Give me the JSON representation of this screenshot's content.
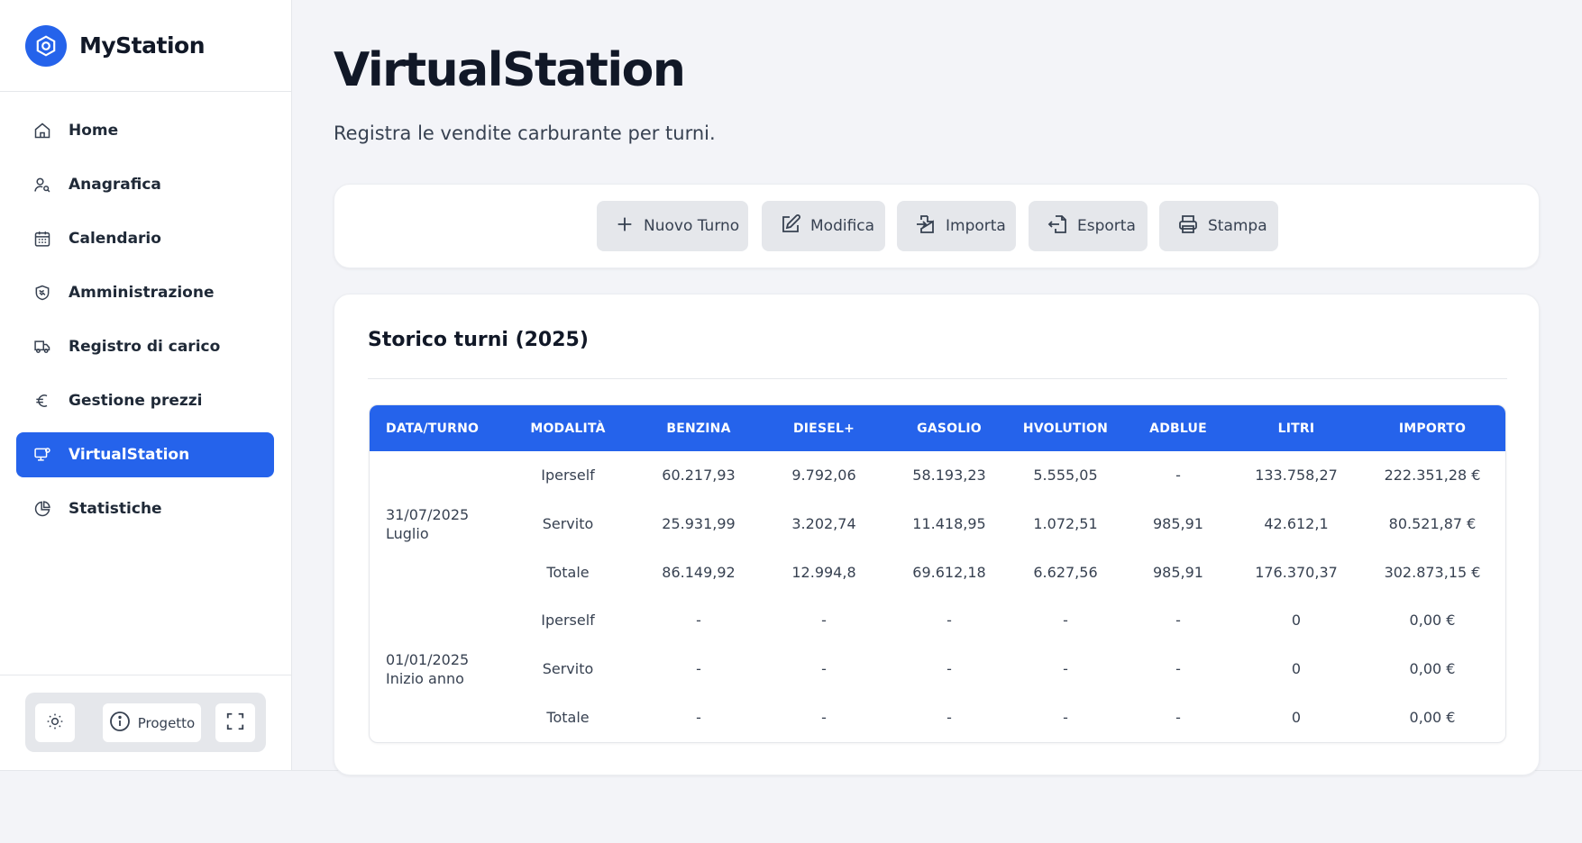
{
  "app": {
    "name": "MyStation",
    "accent": "#2563eb"
  },
  "sidebar": {
    "items": [
      {
        "label": "Home",
        "icon": "home-icon",
        "active": false
      },
      {
        "label": "Anagrafica",
        "icon": "user-search-icon",
        "active": false
      },
      {
        "label": "Calendario",
        "icon": "calendar-icon",
        "active": false
      },
      {
        "label": "Amministrazione",
        "icon": "handshake-icon",
        "active": false
      },
      {
        "label": "Registro di carico",
        "icon": "truck-icon",
        "active": false
      },
      {
        "label": "Gestione prezzi",
        "icon": "euro-icon",
        "active": false
      },
      {
        "label": "VirtualStation",
        "icon": "monitor-icon",
        "active": true
      },
      {
        "label": "Statistiche",
        "icon": "pie-chart-icon",
        "active": false
      }
    ],
    "footer": {
      "theme_icon": "sun-icon",
      "project_label": "Progetto",
      "project_icon": "info-icon",
      "fullscreen_icon": "fullscreen-icon"
    }
  },
  "page": {
    "title": "VirtualStation",
    "subtitle": "Registra le vendite carburante per turni."
  },
  "toolbar": {
    "buttons": [
      {
        "label": "Nuovo Turno",
        "icon": "plus-icon"
      },
      {
        "label": "Modifica",
        "icon": "edit-icon"
      },
      {
        "label": "Importa",
        "icon": "import-icon"
      },
      {
        "label": "Esporta",
        "icon": "export-icon"
      },
      {
        "label": "Stampa",
        "icon": "printer-icon"
      }
    ]
  },
  "history": {
    "title": "Storico turni (2025)",
    "columns": [
      "DATA/TURNO",
      "MODALITÀ",
      "BENZINA",
      "DIESEL+",
      "GASOLIO",
      "HVOLUTION",
      "ADBLUE",
      "LITRI",
      "IMPORTO"
    ],
    "groups": [
      {
        "date": "31/07/2025",
        "name": "Luglio",
        "rows": [
          {
            "mode": "Iperself",
            "benzina": "60.217,93",
            "diesel": "9.792,06",
            "gasolio": "58.193,23",
            "hvolution": "5.555,05",
            "adblue": "-",
            "litri": "133.758,27",
            "importo": "222.351,28 €"
          },
          {
            "mode": "Servito",
            "benzina": "25.931,99",
            "diesel": "3.202,74",
            "gasolio": "11.418,95",
            "hvolution": "1.072,51",
            "adblue": "985,91",
            "litri": "42.612,1",
            "importo": "80.521,87 €"
          },
          {
            "mode": "Totale",
            "benzina": "86.149,92",
            "diesel": "12.994,8",
            "gasolio": "69.612,18",
            "hvolution": "6.627,56",
            "adblue": "985,91",
            "litri": "176.370,37",
            "importo": "302.873,15 €"
          }
        ]
      },
      {
        "date": "01/01/2025",
        "name": "Inizio anno",
        "rows": [
          {
            "mode": "Iperself",
            "benzina": "-",
            "diesel": "-",
            "gasolio": "-",
            "hvolution": "-",
            "adblue": "-",
            "litri": "0",
            "importo": "0,00 €"
          },
          {
            "mode": "Servito",
            "benzina": "-",
            "diesel": "-",
            "gasolio": "-",
            "hvolution": "-",
            "adblue": "-",
            "litri": "0",
            "importo": "0,00 €"
          },
          {
            "mode": "Totale",
            "benzina": "-",
            "diesel": "-",
            "gasolio": "-",
            "hvolution": "-",
            "adblue": "-",
            "litri": "0",
            "importo": "0,00 €"
          }
        ]
      }
    ]
  }
}
